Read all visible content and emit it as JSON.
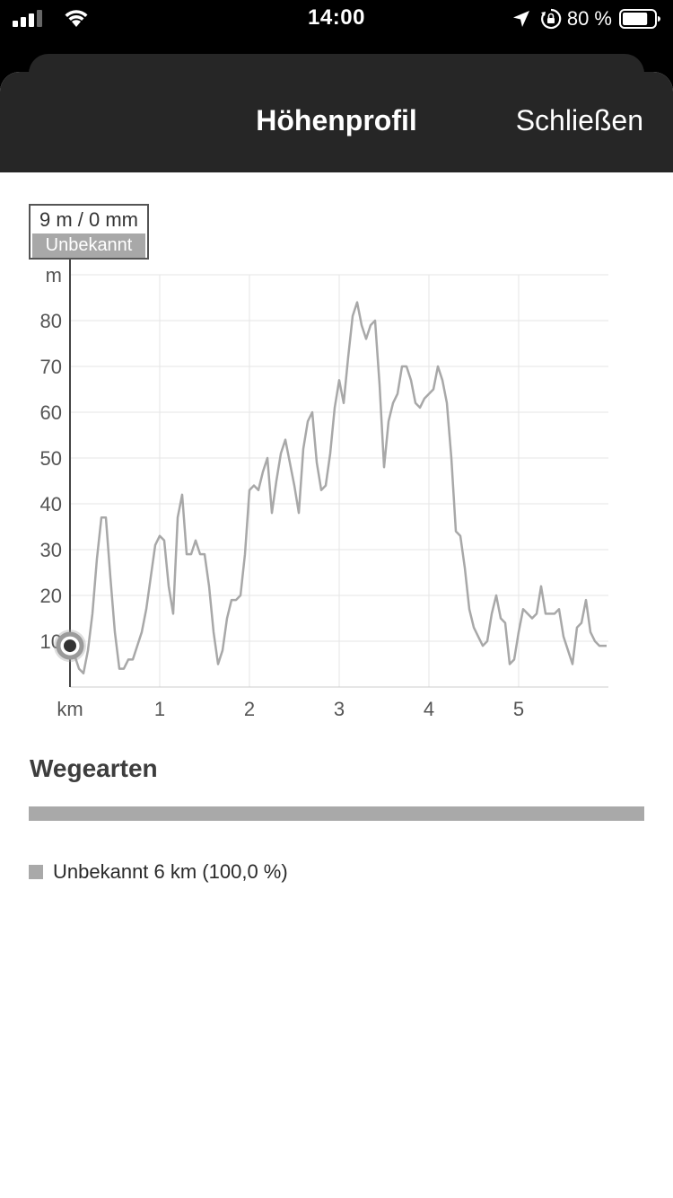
{
  "status_bar": {
    "time": "14:00",
    "battery_percent": "80 %",
    "battery_level": 0.8,
    "icons": [
      "cellular-signal-icon",
      "wifi-icon",
      "location-arrow-icon",
      "orientation-lock-icon",
      "battery-icon"
    ]
  },
  "nav": {
    "title": "Höhenprofil",
    "close_label": "Schließen"
  },
  "tooltip": {
    "value": "9 m / 0 mm",
    "type": "Unbekannt"
  },
  "chart_data": {
    "type": "line",
    "xlabel": "km",
    "ylabel": "m",
    "x_ticks": [
      "1",
      "2",
      "3",
      "4",
      "5"
    ],
    "y_ticks": [
      "10",
      "20",
      "30",
      "40",
      "50",
      "60",
      "70",
      "80"
    ],
    "xlim": [
      0,
      6
    ],
    "ylim": [
      0,
      90
    ],
    "grid": true,
    "line_color": "#a8a8a8",
    "selected_point": {
      "x": 0,
      "y": 9
    },
    "series": [
      {
        "x": [
          0,
          0.05,
          0.1,
          0.15,
          0.2,
          0.25,
          0.3,
          0.35,
          0.4,
          0.45,
          0.5,
          0.55,
          0.6,
          0.65,
          0.7,
          0.75,
          0.8,
          0.85,
          0.9,
          0.95,
          1.0,
          1.05,
          1.1,
          1.15,
          1.2,
          1.25,
          1.3,
          1.35,
          1.4,
          1.45,
          1.5,
          1.55,
          1.6,
          1.65,
          1.7,
          1.75,
          1.8,
          1.85,
          1.9,
          1.95,
          2.0,
          2.05,
          2.1,
          2.15,
          2.2,
          2.25,
          2.3,
          2.35,
          2.4,
          2.45,
          2.5,
          2.55,
          2.6,
          2.65,
          2.7,
          2.75,
          2.8,
          2.85,
          2.9,
          2.95,
          3.0,
          3.05,
          3.1,
          3.15,
          3.2,
          3.25,
          3.3,
          3.35,
          3.4,
          3.45,
          3.5,
          3.55,
          3.6,
          3.65,
          3.7,
          3.75,
          3.8,
          3.85,
          3.9,
          3.95,
          4.0,
          4.05,
          4.1,
          4.15,
          4.2,
          4.25,
          4.3,
          4.35,
          4.4,
          4.45,
          4.5,
          4.55,
          4.6,
          4.65,
          4.7,
          4.75,
          4.8,
          4.85,
          4.9,
          4.95,
          5.0,
          5.05,
          5.1,
          5.15,
          5.2,
          5.25,
          5.3,
          5.35,
          5.4,
          5.45,
          5.5,
          5.55,
          5.6,
          5.65,
          5.7,
          5.75,
          5.8,
          5.85,
          5.9,
          5.98
        ],
        "y": [
          9,
          7,
          4,
          3,
          8,
          16,
          28,
          37,
          37,
          24,
          12,
          4,
          4,
          6,
          6,
          9,
          12,
          17,
          24,
          31,
          33,
          32,
          22,
          16,
          37,
          42,
          29,
          29,
          32,
          29,
          29,
          22,
          12,
          5,
          8,
          15,
          19,
          19,
          20,
          29,
          43,
          44,
          43,
          47,
          50,
          38,
          45,
          51,
          54,
          49,
          44,
          38,
          52,
          58,
          60,
          49,
          43,
          44,
          51,
          61,
          67,
          62,
          72,
          81,
          84,
          79,
          76,
          79,
          80,
          66,
          48,
          58,
          62,
          64,
          70,
          70,
          67,
          62,
          61,
          63,
          64,
          65,
          70,
          67,
          62,
          50,
          34,
          33,
          26,
          17,
          13,
          11,
          9,
          10,
          16,
          20,
          15,
          14,
          5,
          6,
          12,
          17,
          16,
          15,
          16,
          22,
          16,
          16,
          16,
          17,
          11,
          8,
          5,
          13,
          14,
          19,
          12,
          10,
          9,
          9
        ]
      }
    ]
  },
  "section": {
    "title": "Wegearten"
  },
  "legend": {
    "items": [
      {
        "label": "Unbekannt 6 km (100,0 %)",
        "color": "#a9a9a9",
        "share": 1.0
      }
    ]
  }
}
